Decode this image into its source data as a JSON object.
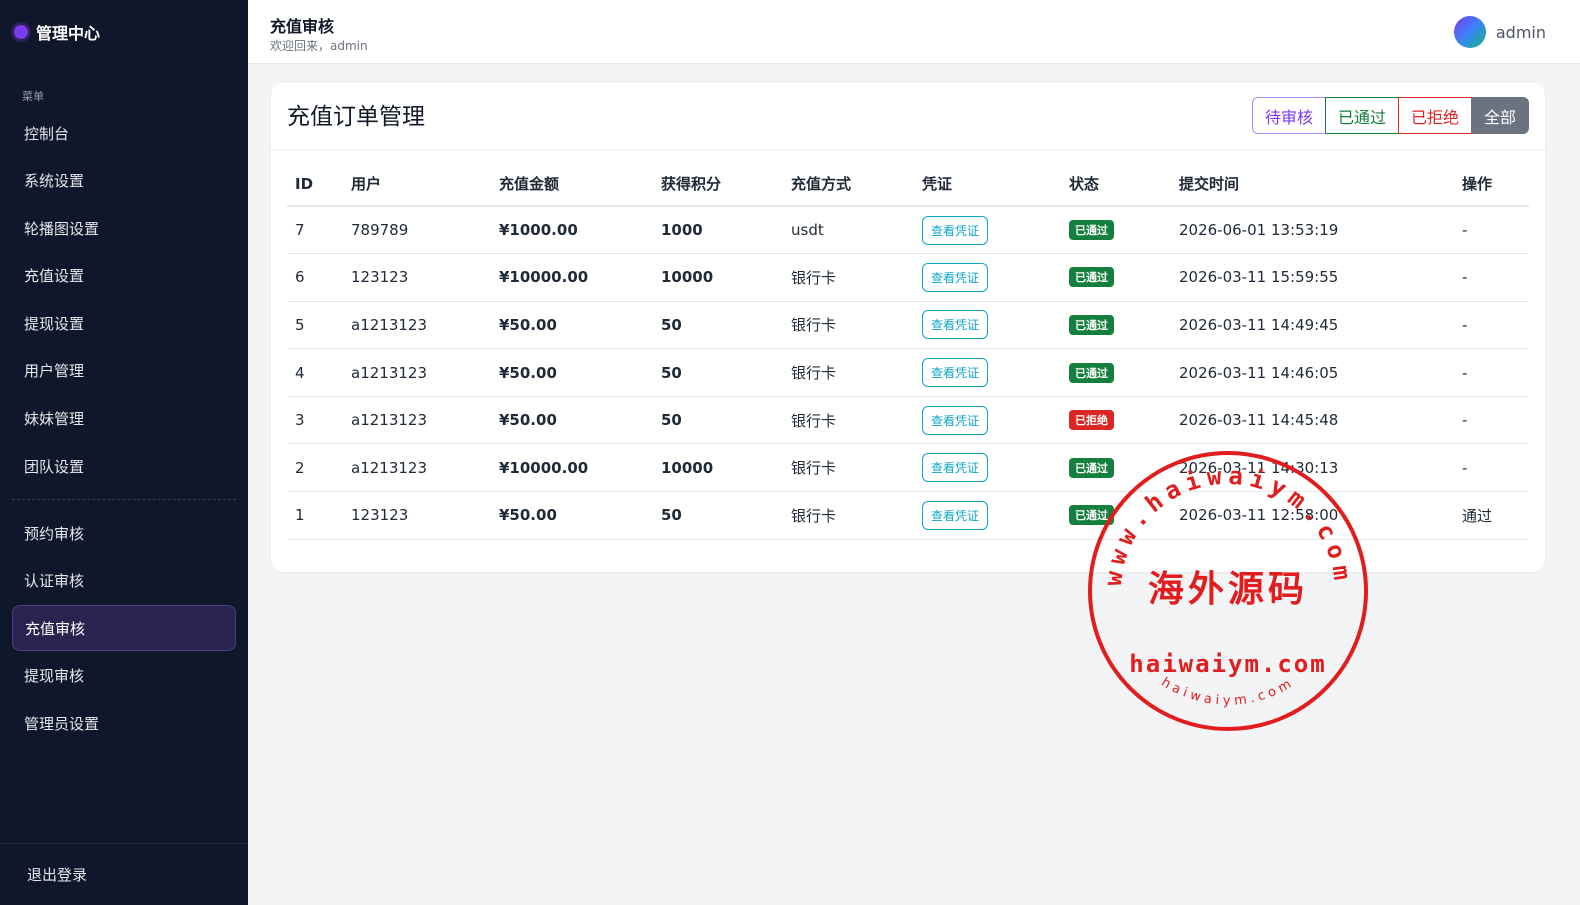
{
  "sidebar": {
    "brand": "管理中心",
    "section": "菜单",
    "items": [
      "控制台",
      "系统设置",
      "轮播图设置",
      "充值设置",
      "提现设置",
      "用户管理",
      "妹妹管理",
      "团队设置"
    ],
    "items2": [
      "预约审核",
      "认证审核",
      "充值审核",
      "提现审核",
      "管理员设置"
    ],
    "active": "充值审核",
    "logout": "退出登录"
  },
  "header": {
    "title": "充值审核",
    "welcome": "欢迎回来，admin",
    "username": "admin"
  },
  "main": {
    "title": "充值订单管理",
    "filters": {
      "pending": "待审核",
      "passed": "已通过",
      "rejected": "已拒绝",
      "all": "全部"
    },
    "columns": [
      "ID",
      "用户",
      "充值金额",
      "获得积分",
      "充值方式",
      "凭证",
      "状态",
      "提交时间",
      "操作"
    ],
    "rows": [
      {
        "id": "7",
        "user": "789789",
        "amount": "¥1000.00",
        "points": "1000",
        "method": "usdt",
        "voucher": "查看凭证",
        "status": "已通过",
        "status_type": "ok",
        "time": "2026-06-01 13:53:19",
        "action": "-"
      },
      {
        "id": "6",
        "user": "123123",
        "amount": "¥10000.00",
        "points": "10000",
        "method": "银行卡",
        "voucher": "查看凭证",
        "status": "已通过",
        "status_type": "ok",
        "time": "2026-03-11 15:59:55",
        "action": "-"
      },
      {
        "id": "5",
        "user": "a1213123",
        "amount": "¥50.00",
        "points": "50",
        "method": "银行卡",
        "voucher": "查看凭证",
        "status": "已通过",
        "status_type": "ok",
        "time": "2026-03-11 14:49:45",
        "action": "-"
      },
      {
        "id": "4",
        "user": "a1213123",
        "amount": "¥50.00",
        "points": "50",
        "method": "银行卡",
        "voucher": "查看凭证",
        "status": "已通过",
        "status_type": "ok",
        "time": "2026-03-11 14:46:05",
        "action": "-"
      },
      {
        "id": "3",
        "user": "a1213123",
        "amount": "¥50.00",
        "points": "50",
        "method": "银行卡",
        "voucher": "查看凭证",
        "status": "已拒绝",
        "status_type": "no",
        "time": "2026-03-11 14:45:48",
        "action": "-"
      },
      {
        "id": "2",
        "user": "a1213123",
        "amount": "¥10000.00",
        "points": "10000",
        "method": "银行卡",
        "voucher": "查看凭证",
        "status": "已通过",
        "status_type": "ok",
        "time": "2026-03-11 14:30:13",
        "action": "-"
      },
      {
        "id": "1",
        "user": "123123",
        "amount": "¥50.00",
        "points": "50",
        "method": "银行卡",
        "voucher": "查看凭证",
        "status": "已通过",
        "status_type": "ok",
        "time": "2026-03-11 12:58:00",
        "action": "通过"
      }
    ]
  },
  "stamp": {
    "arc_text": "www.haiwaiym.com",
    "center_text": "海外源码",
    "domain_text": "haiwaiym.com",
    "bottom_arc": "haiwaiym.com",
    "color": "#e11d1d"
  },
  "colors": {
    "sidebar_bg": "#0f172a",
    "active_bg": "#2a2350",
    "amount": "#dc2626",
    "points": "#15803d",
    "accent_purple": "#7c3aed"
  }
}
